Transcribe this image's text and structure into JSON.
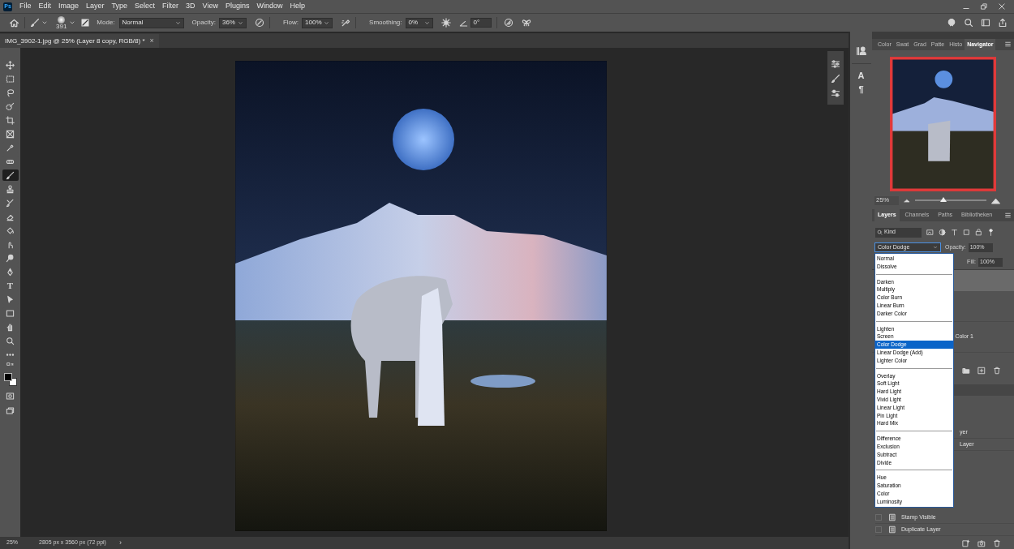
{
  "app": {
    "logo": "Ps"
  },
  "menu": [
    "File",
    "Edit",
    "Image",
    "Layer",
    "Type",
    "Select",
    "Filter",
    "3D",
    "View",
    "Plugins",
    "Window",
    "Help"
  ],
  "options_bar": {
    "brush_size": "391",
    "mode_label": "Mode:",
    "mode": "Normal",
    "opacity_label": "Opacity:",
    "opacity": "36%",
    "flow_label": "Flow:",
    "flow": "100%",
    "smoothing_label": "Smoothing:",
    "smoothing": "0%",
    "angle": "0°"
  },
  "document_tab": {
    "title": "IMG_3902-1.jpg @ 25% (Layer 8 copy, RGB/8) *",
    "close": "×"
  },
  "tools": [
    {
      "selected": false
    },
    {
      "selected": false
    },
    {
      "selected": false
    },
    {
      "selected": false
    },
    {
      "selected": false
    },
    {
      "selected": false
    },
    {
      "selected": false
    },
    {
      "selected": false
    },
    {
      "selected": true
    },
    {
      "selected": false
    },
    {
      "selected": false
    },
    {
      "selected": false
    },
    {
      "selected": false
    },
    {
      "selected": false
    },
    {
      "selected": false
    },
    {
      "selected": false
    },
    {
      "selected": false,
      "glyph": "T"
    },
    {
      "selected": false
    },
    {
      "selected": false
    },
    {
      "selected": false
    },
    {
      "selected": false
    },
    {
      "selected": false
    }
  ],
  "mini_panel": {
    "glyphs": [
      "A",
      "¶"
    ]
  },
  "panel_tabs": [
    {
      "label": "Color",
      "selected": false
    },
    {
      "label": "Swat",
      "selected": false
    },
    {
      "label": "Grad",
      "selected": false
    },
    {
      "label": "Patte",
      "selected": false
    },
    {
      "label": "Histo",
      "selected": false
    },
    {
      "label": "Navigator",
      "selected": true
    }
  ],
  "navigator": {
    "zoom": "25%",
    "level": 0.4
  },
  "layers_tabs": [
    {
      "label": "Layers",
      "selected": true
    },
    {
      "label": "Channels",
      "selected": false
    },
    {
      "label": "Paths",
      "selected": false
    },
    {
      "label": "Bibliotheken",
      "selected": false
    }
  ],
  "layer_filter": {
    "kind": "Kind"
  },
  "blend": {
    "mode": "Color Dodge",
    "opacity_label": "Opacity:",
    "opacity": "100%",
    "fill_label": "Fill:",
    "fill": "100%"
  },
  "blend_menu": [
    {
      "options": [
        {
          "label": "Normal",
          "selected": false
        },
        {
          "label": "Dissolve",
          "selected": false
        }
      ]
    },
    {
      "options": [
        {
          "label": "Darken",
          "selected": false
        },
        {
          "label": "Multiply",
          "selected": false
        },
        {
          "label": "Color Burn",
          "selected": false
        },
        {
          "label": "Linear Burn",
          "selected": false
        },
        {
          "label": "Darker Color",
          "selected": false
        }
      ]
    },
    {
      "options": [
        {
          "label": "Lighten",
          "selected": false
        },
        {
          "label": "Screen",
          "selected": false
        },
        {
          "label": "Color Dodge",
          "selected": true
        },
        {
          "label": "Linear Dodge (Add)",
          "selected": false
        },
        {
          "label": "Lighter Color",
          "selected": false
        }
      ]
    },
    {
      "options": [
        {
          "label": "Overlay",
          "selected": false
        },
        {
          "label": "Soft Light",
          "selected": false
        },
        {
          "label": "Hard Light",
          "selected": false
        },
        {
          "label": "Vivid Light",
          "selected": false
        },
        {
          "label": "Linear Light",
          "selected": false
        },
        {
          "label": "Pin Light",
          "selected": false
        },
        {
          "label": "Hard Mix",
          "selected": false
        }
      ]
    },
    {
      "options": [
        {
          "label": "Difference",
          "selected": false
        },
        {
          "label": "Exclusion",
          "selected": false
        },
        {
          "label": "Subtract",
          "selected": false
        },
        {
          "label": "Divide",
          "selected": false
        }
      ]
    },
    {
      "options": [
        {
          "label": "Hue",
          "selected": false
        },
        {
          "label": "Saturation",
          "selected": false
        },
        {
          "label": "Color",
          "selected": false
        },
        {
          "label": "Luminosity",
          "selected": false
        }
      ]
    }
  ],
  "layers": [
    {
      "name": "Color 1"
    }
  ],
  "history": [
    {
      "label": "yer"
    },
    {
      "label": "Layer"
    },
    {
      "label": "Stamp Visible"
    },
    {
      "label": "Duplicate Layer"
    }
  ],
  "status_bar": {
    "zoom": "25%",
    "document_size": "2805 px x 3560 px (72 ppi)",
    "arrow": "›"
  }
}
